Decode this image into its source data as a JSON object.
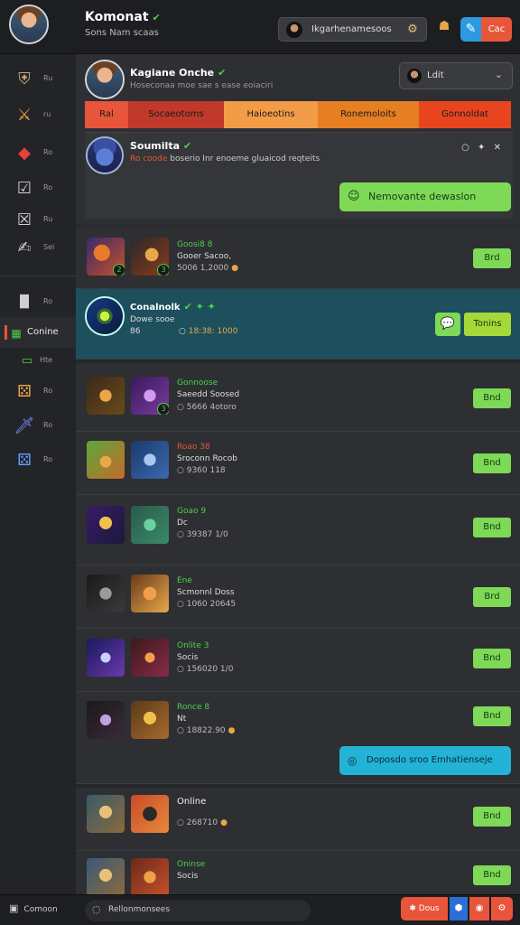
{
  "header": {
    "title": "Komonat",
    "subtitle": "Sons Nam scaas",
    "search_text": "Ikgarhenamesoos",
    "menu_label": "Cac"
  },
  "sidebar": {
    "items": [
      {
        "label": "Ru",
        "icon": "armor-icon",
        "color": "#c9a67a"
      },
      {
        "label": "ru",
        "icon": "swords-icon",
        "color": "#e8a74a"
      },
      {
        "label": "Ro",
        "icon": "gem-icon",
        "color": "#e8403a"
      },
      {
        "label": "Ro",
        "icon": "check-icon",
        "color": "#cfcfcf"
      },
      {
        "label": "Ru",
        "icon": "crossed-icon",
        "color": "#cfcfcf"
      },
      {
        "label": "Sei",
        "icon": "tag-icon",
        "color": "#cfcfcf"
      },
      {
        "label": "Ro",
        "icon": "panel-icon",
        "color": "#cfcfcf"
      },
      {
        "label": "Conine",
        "icon": "grid-icon",
        "color": "#4bd04b",
        "active": true
      },
      {
        "label": "Hte",
        "icon": "tray-icon",
        "color": "#4bd04b"
      },
      {
        "label": "Ro",
        "icon": "dice-icon",
        "color": "#e8a74a"
      },
      {
        "label": "Ro",
        "icon": "sword-card-icon",
        "color": "#7b8cff"
      },
      {
        "label": "Ro",
        "icon": "dice-icon",
        "color": "#5aa0ff"
      }
    ]
  },
  "profile": {
    "name": "Kagiane Onche",
    "description": "Hoseconaa moe sae s ease eoiaciri",
    "select_label": "Ldit"
  },
  "tabs": [
    {
      "label": "Ral",
      "color": "#e8553a"
    },
    {
      "label": "Socaeotoms",
      "color": "#c0392b"
    },
    {
      "label": "Haioeotins",
      "color": "#f39c48"
    },
    {
      "label": "Ronemoloits",
      "color": "#e67e22"
    },
    {
      "label": "Gonnoldat",
      "color": "#e8451f"
    }
  ],
  "featured": {
    "name": "Soumilta",
    "desc_highlight": "Ro coode",
    "desc_rest": " boserio Inr enoeme gluaicod reqteits",
    "icons_text": "○ ✦ ✕",
    "button_label": "Nemovante dewaslon"
  },
  "highlight": {
    "name": "Conalnolk",
    "sub": "Dowe sooe",
    "meta": "86",
    "time": "18:38: 1000",
    "button_label": "Tonins"
  },
  "rows": [
    {
      "title": "Goosi8 8",
      "sub": "Gooer Sacoo,",
      "meta": "5006 1,2000",
      "button": "Brd"
    },
    {
      "title": "Gonnoose",
      "sub": "Saeedd Soosed",
      "meta": "5666 4otoro",
      "button": "Bnd"
    },
    {
      "title": "Roao 38",
      "sub": "Sroconn Rocob",
      "meta": "9360 118",
      "button": "Bnd"
    },
    {
      "title": "Goao 9",
      "sub": "Dc",
      "meta": "39387 1/0",
      "button": "Bnd"
    },
    {
      "title": "Ene",
      "sub": "Scmonnl Doss",
      "meta": "1060 20645",
      "button": "Brd"
    },
    {
      "title": "Onlite 3",
      "sub": "Socis",
      "meta": "156020 1/0",
      "button": "Bnd"
    },
    {
      "title": "Ronce 8",
      "sub": "Nt",
      "meta": "18822.90",
      "button": "Bnd"
    },
    {
      "title": "Online",
      "sub": "",
      "meta": "268710",
      "button": "Bnd"
    },
    {
      "title": "Oninse",
      "sub": "Socis",
      "meta": "",
      "button": "Bnd"
    }
  ],
  "cyan_button_label": "Doposdo sroo Emhatienseje",
  "footer": {
    "left_label": "Comoon",
    "search_text": "Rellonmonsees",
    "btn1_label": "Dous"
  }
}
